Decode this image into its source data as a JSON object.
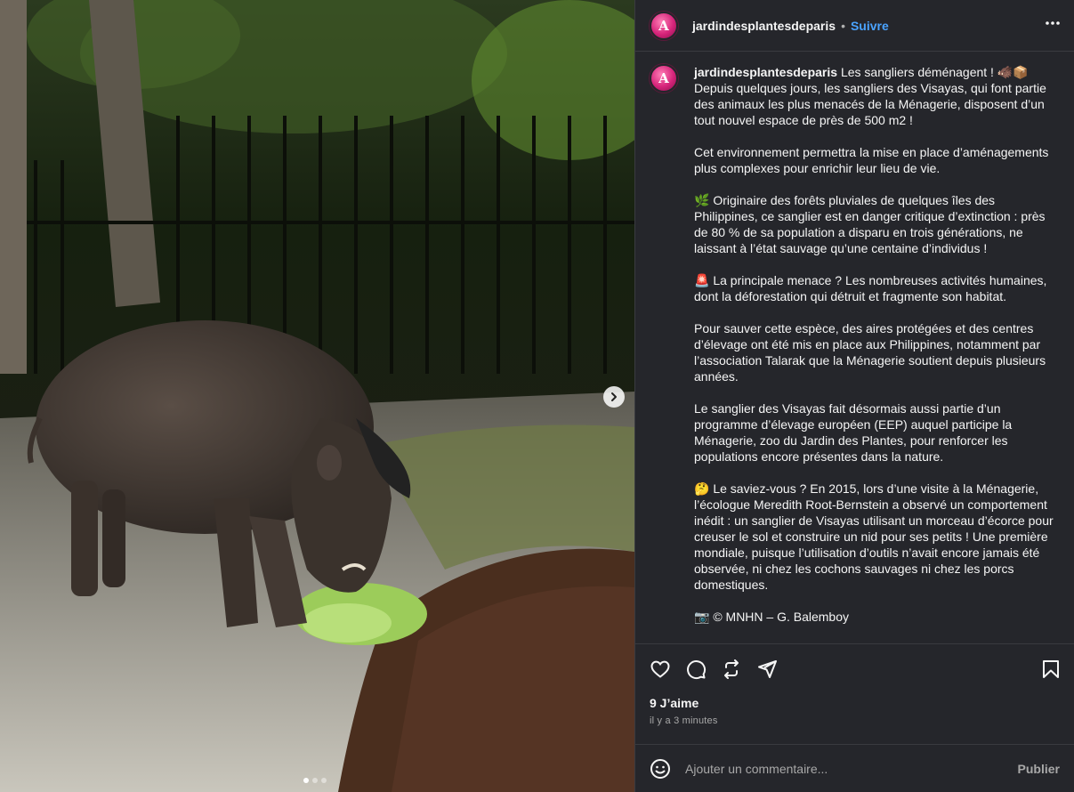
{
  "post": {
    "username": "jardindesplantesdeparis",
    "separator": "•",
    "follow_label": "Suivre",
    "more_icon": "more-horizontal-icon",
    "avatar_letter": "A",
    "caption_user": "jardindesplantesdeparis",
    "caption_first_line": " Les sangliers déménagent ! 🐗📦",
    "caption_body": "\nDepuis quelques jours, les sangliers des Visayas, qui font partie des animaux les plus menacés de la Ménagerie, disposent d’un tout nouvel espace de près de 500 m2 !\n\nCet environnement permettra la mise en place d’aménagements plus complexes pour enrichir leur lieu de vie.\n\n🌿 Originaire des forêts pluviales de quelques îles des Philippines, ce sanglier est en danger critique d’extinction : près de 80 % de sa population a disparu en trois générations, ne laissant à l’état sauvage qu’une centaine d’individus !\n\n🚨 La principale menace ? Les nombreuses activités humaines, dont la déforestation qui détruit et fragmente son habitat.\n\nPour sauver cette espèce, des aires protégées et des centres d’élevage ont été mis en place aux Philippines, notamment par l’association Talarak que la Ménagerie soutient depuis plusieurs années.\n\nLe sanglier des Visayas fait désormais aussi partie d’un programme d’élevage européen (EEP) auquel participe la Ménagerie, zoo du Jardin des Plantes, pour renforcer les populations encore présentes dans la nature.\n\n🤔 Le saviez-vous ? En 2015, lors d’une visite à la Ménagerie, l’écologue Meredith Root-Bernstein a observé un comportement inédit : un sanglier de Visayas utilisant un morceau d’écorce pour creuser le sol et construire un nid pour ses petits ! Une première mondiale, puisque l’utilisation d’outils n’avait encore jamais été observée, ni chez les cochons sauvages ni chez les porcs domestiques.\n\n📷 © MNHN – G. Balemboy",
    "likes": "9 J’aime",
    "time_ago": "il y a 3 minutes"
  },
  "comment": {
    "placeholder": "Ajouter un commentaire...",
    "publish_label": "Publier"
  },
  "carousel": {
    "total_slides": 3,
    "active_slide": 1
  },
  "colors": {
    "panel_bg": "#25262b",
    "accent_link": "#4aa3ff",
    "avatar_pink": "#d6247a"
  }
}
